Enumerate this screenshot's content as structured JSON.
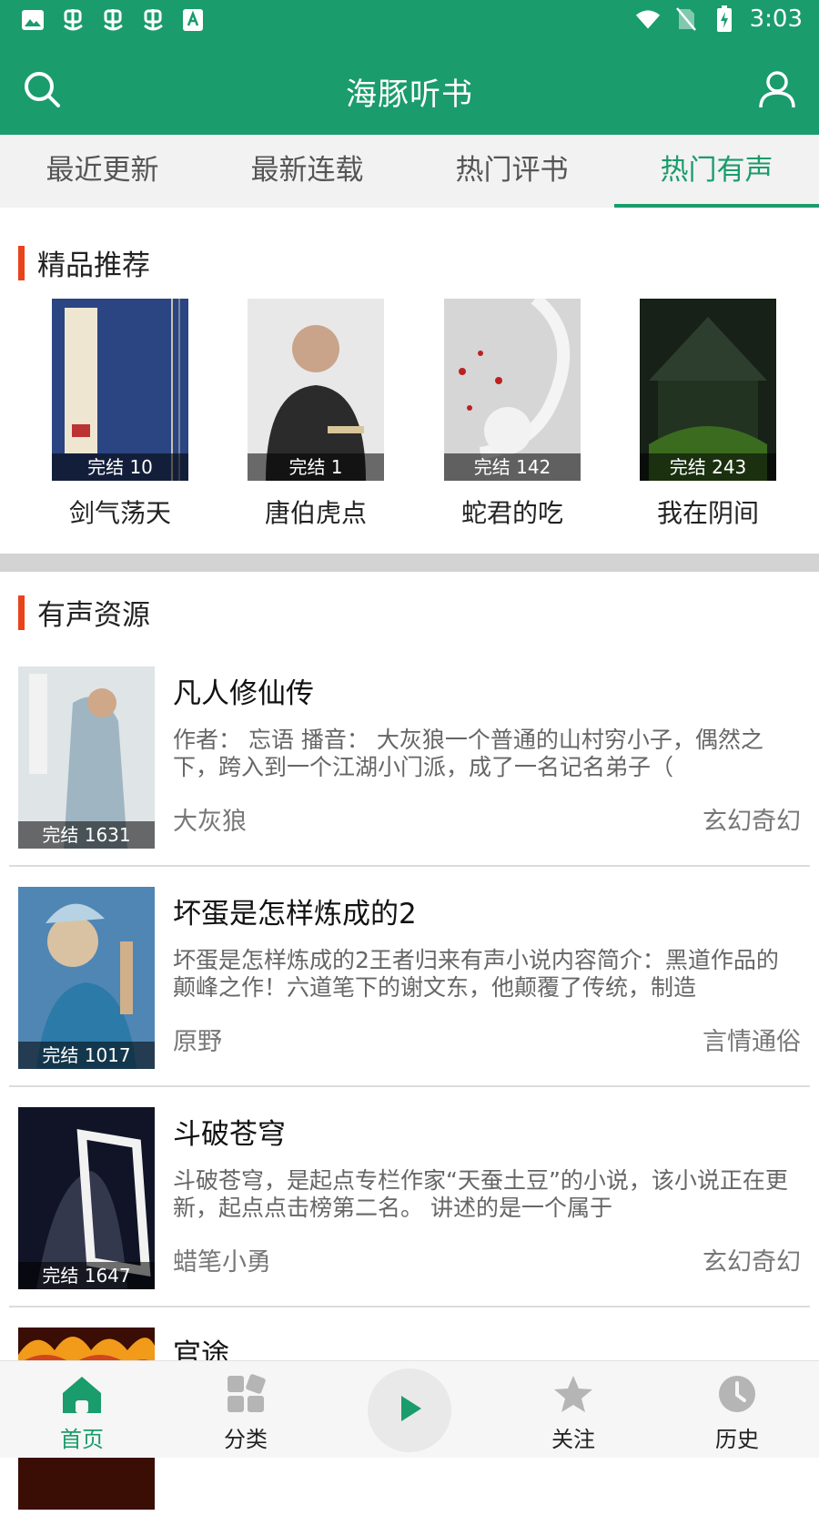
{
  "status_bar": {
    "time": "3:03",
    "left_icons": [
      "image-icon",
      "bug-icon",
      "bug-icon",
      "bug-icon",
      "font-icon"
    ],
    "right_icons": [
      "wifi-icon",
      "no-sim-icon",
      "battery-icon"
    ]
  },
  "app": {
    "title": "海豚听书",
    "accent": "#1a9c6c",
    "search_icon": "search-icon",
    "user_icon": "user-icon"
  },
  "tabs": [
    {
      "label": "最近更新",
      "active": false
    },
    {
      "label": "最新连载",
      "active": false
    },
    {
      "label": "热门评书",
      "active": false
    },
    {
      "label": "热门有声",
      "active": true
    }
  ],
  "featured": {
    "title": "精品推荐",
    "items": [
      {
        "name": "剑气荡天",
        "badge": "完结 10"
      },
      {
        "name": "唐伯虎点",
        "badge": "完结 1"
      },
      {
        "name": "蛇君的吃",
        "badge": "完结 142"
      },
      {
        "name": "我在阴间",
        "badge": "完结 243"
      }
    ]
  },
  "audio_resources": {
    "title": "有声资源",
    "items": [
      {
        "title": "凡人修仙传",
        "desc": "作者： 忘语 播音： 大灰狼一个普通的山村穷小子，偶然之下，跨入到一个江湖小门派，成了一名记名弟子（",
        "author": "大灰狼",
        "category": "玄幻奇幻",
        "badge": "完结 1631"
      },
      {
        "title": "坏蛋是怎样炼成的2",
        "desc": "坏蛋是怎样炼成的2王者归来有声小说内容简介：黑道作品的颠峰之作！六道笔下的谢文东，他颠覆了传统，制造",
        "author": "原野",
        "category": "言情通俗",
        "badge": "完结 1017"
      },
      {
        "title": "斗破苍穹",
        "desc": " 斗破苍穹，是起点专栏作家“天蚕土豆”的小说，该小说正在更新，起点点击榜第二名。 讲述的是一个属于",
        "author": "蜡笔小勇",
        "category": "玄幻奇幻",
        "badge": "完结 1647"
      },
      {
        "title": "官途",
        "desc": "",
        "author": "",
        "category": "",
        "badge": ""
      }
    ]
  },
  "bottom_nav": [
    {
      "label": "首页",
      "icon": "home-icon",
      "active": true
    },
    {
      "label": "分类",
      "icon": "grid-icon",
      "active": false
    },
    {
      "label": "",
      "icon": "play-icon",
      "active": false
    },
    {
      "label": "关注",
      "icon": "star-icon",
      "active": false
    },
    {
      "label": "历史",
      "icon": "clock-icon",
      "active": false
    }
  ]
}
